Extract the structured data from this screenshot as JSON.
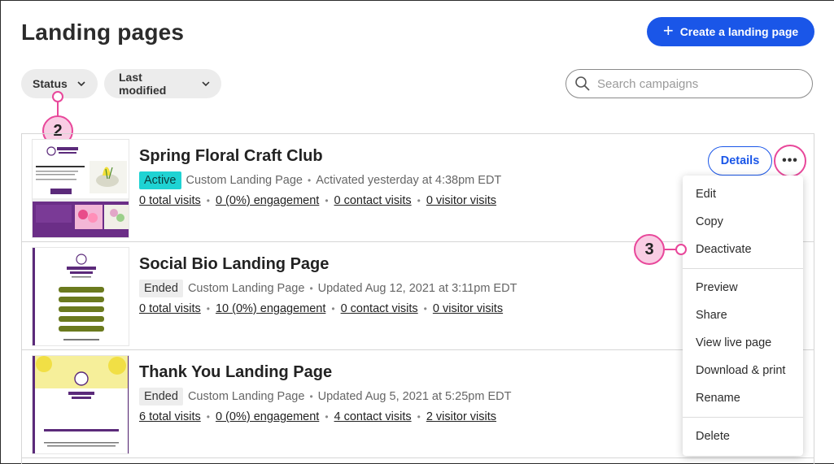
{
  "header": {
    "title": "Landing pages",
    "create_label": "Create a landing page"
  },
  "filters": {
    "status_label": "Status",
    "modified_label": "Last modified"
  },
  "search": {
    "placeholder": "Search campaigns"
  },
  "callouts": [
    "2",
    "3"
  ],
  "pages": [
    {
      "title": "Spring Floral Craft Club",
      "status": "Active",
      "type": "Custom Landing Page",
      "date": "Activated yesterday at 4:38pm EDT",
      "stats": [
        "0 total visits",
        "0 (0%) engagement",
        "0 contact visits",
        "0 visitor visits"
      ]
    },
    {
      "title": "Social Bio Landing Page",
      "status": "Ended",
      "type": "Custom Landing Page",
      "date": "Updated Aug 12, 2021 at 3:11pm EDT",
      "stats": [
        "0 total visits",
        "10 (0%) engagement",
        "0 contact visits",
        "0 visitor visits"
      ]
    },
    {
      "title": "Thank You Landing Page",
      "status": "Ended",
      "type": "Custom Landing Page",
      "date": "Updated Aug 5, 2021 at 5:25pm EDT",
      "stats": [
        "6 total visits",
        "0 (0%) engagement",
        "4 contact visits",
        "2 visitor visits"
      ]
    }
  ],
  "row_actions": {
    "details_label": "Details",
    "more_label": "•••"
  },
  "menu": {
    "items": [
      "Edit",
      "Copy",
      "Deactivate",
      "Preview",
      "Share",
      "View live page",
      "Download & print",
      "Rename",
      "Delete"
    ]
  },
  "thumbnails": {
    "brand": "SUNNY'S FLORIST",
    "thumb1_heading": "Welcome to the Spring crafting season!",
    "thumb1_button": "Register today",
    "thumb3_caption": "Thanks for your feedback!"
  },
  "colors": {
    "accent_blue": "#1a56e8",
    "callout_pink": "#e8479a",
    "active_badge": "#1fd3d3",
    "brand_purple": "#5b2a7a",
    "brand_green": "#6b7a1e"
  }
}
